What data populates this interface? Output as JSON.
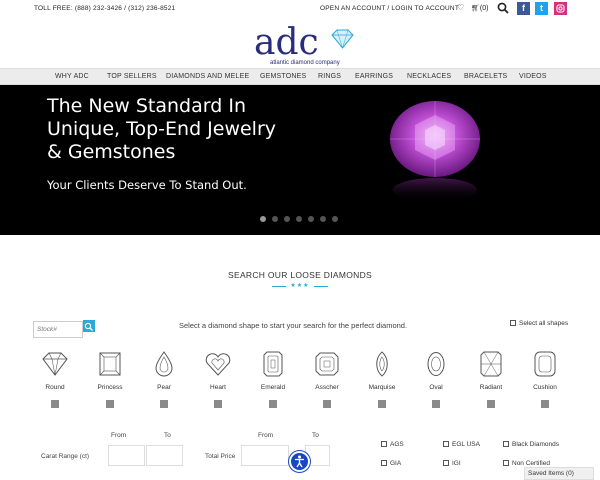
{
  "topbar": {
    "toll_free": "TOLL FREE: (888) 232-3426 / (312) 236-8521",
    "account": "OPEN AN ACCOUNT / LOGIN TO ACCOUNT",
    "cart_count": "(0)",
    "social": {
      "facebook": "f",
      "twitter": "t"
    }
  },
  "logo": {
    "main": "adc",
    "tagline": "atlantic diamond company"
  },
  "nav": [
    "WHY ADC",
    "TOP SELLERS",
    "DIAMONDS AND MELEE",
    "GEMSTONES",
    "RINGS",
    "EARRINGS",
    "NECKLACES",
    "BRACELETS",
    "VIDEOS"
  ],
  "hero": {
    "title_line1": "The New Standard In",
    "title_line2": "Unique, Top-End Jewelry",
    "title_line3": "& Gemstones",
    "subtitle": "Your Clients Deserve To Stand Out.",
    "slide_count": 7,
    "active_slide": 1
  },
  "search": {
    "title": "SEARCH OUR LOOSE DIAMONDS",
    "stars": "★★★",
    "stock_placeholder": "Stock#",
    "instruction": "Select a diamond shape to start your search for the perfect diamond.",
    "select_all": "Select all shapes",
    "shapes": [
      "Round",
      "Princess",
      "Pear",
      "Heart",
      "Emerald",
      "Asscher",
      "Marquise",
      "Oval",
      "Radiant",
      "Cushion"
    ]
  },
  "filters": {
    "from": "From",
    "to": "To",
    "carat_label": "Carat Range (ct)",
    "price_label": "Total Price",
    "certs": [
      "AGS",
      "EGL USA",
      "Black Diamonds",
      "GIA",
      "IGI",
      "Non Certified"
    ]
  },
  "saved_items": "Saved Items (0)",
  "colors": {
    "accent": "#29a9d6",
    "logo": "#2a2d7a",
    "hero_bg": "#000000",
    "gem": "#c04fd6"
  }
}
